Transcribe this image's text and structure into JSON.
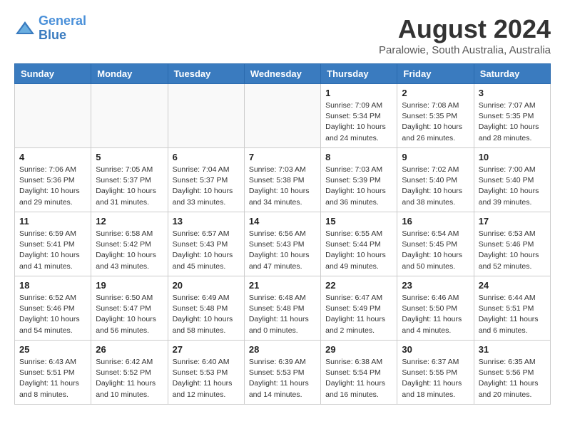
{
  "header": {
    "logo_line1": "General",
    "logo_line2": "Blue",
    "month": "August 2024",
    "location": "Paralowie, South Australia, Australia"
  },
  "weekdays": [
    "Sunday",
    "Monday",
    "Tuesday",
    "Wednesday",
    "Thursday",
    "Friday",
    "Saturday"
  ],
  "weeks": [
    [
      {
        "day": "",
        "info": ""
      },
      {
        "day": "",
        "info": ""
      },
      {
        "day": "",
        "info": ""
      },
      {
        "day": "",
        "info": ""
      },
      {
        "day": "1",
        "info": "Sunrise: 7:09 AM\nSunset: 5:34 PM\nDaylight: 10 hours\nand 24 minutes."
      },
      {
        "day": "2",
        "info": "Sunrise: 7:08 AM\nSunset: 5:35 PM\nDaylight: 10 hours\nand 26 minutes."
      },
      {
        "day": "3",
        "info": "Sunrise: 7:07 AM\nSunset: 5:35 PM\nDaylight: 10 hours\nand 28 minutes."
      }
    ],
    [
      {
        "day": "4",
        "info": "Sunrise: 7:06 AM\nSunset: 5:36 PM\nDaylight: 10 hours\nand 29 minutes."
      },
      {
        "day": "5",
        "info": "Sunrise: 7:05 AM\nSunset: 5:37 PM\nDaylight: 10 hours\nand 31 minutes."
      },
      {
        "day": "6",
        "info": "Sunrise: 7:04 AM\nSunset: 5:37 PM\nDaylight: 10 hours\nand 33 minutes."
      },
      {
        "day": "7",
        "info": "Sunrise: 7:03 AM\nSunset: 5:38 PM\nDaylight: 10 hours\nand 34 minutes."
      },
      {
        "day": "8",
        "info": "Sunrise: 7:03 AM\nSunset: 5:39 PM\nDaylight: 10 hours\nand 36 minutes."
      },
      {
        "day": "9",
        "info": "Sunrise: 7:02 AM\nSunset: 5:40 PM\nDaylight: 10 hours\nand 38 minutes."
      },
      {
        "day": "10",
        "info": "Sunrise: 7:00 AM\nSunset: 5:40 PM\nDaylight: 10 hours\nand 39 minutes."
      }
    ],
    [
      {
        "day": "11",
        "info": "Sunrise: 6:59 AM\nSunset: 5:41 PM\nDaylight: 10 hours\nand 41 minutes."
      },
      {
        "day": "12",
        "info": "Sunrise: 6:58 AM\nSunset: 5:42 PM\nDaylight: 10 hours\nand 43 minutes."
      },
      {
        "day": "13",
        "info": "Sunrise: 6:57 AM\nSunset: 5:43 PM\nDaylight: 10 hours\nand 45 minutes."
      },
      {
        "day": "14",
        "info": "Sunrise: 6:56 AM\nSunset: 5:43 PM\nDaylight: 10 hours\nand 47 minutes."
      },
      {
        "day": "15",
        "info": "Sunrise: 6:55 AM\nSunset: 5:44 PM\nDaylight: 10 hours\nand 49 minutes."
      },
      {
        "day": "16",
        "info": "Sunrise: 6:54 AM\nSunset: 5:45 PM\nDaylight: 10 hours\nand 50 minutes."
      },
      {
        "day": "17",
        "info": "Sunrise: 6:53 AM\nSunset: 5:46 PM\nDaylight: 10 hours\nand 52 minutes."
      }
    ],
    [
      {
        "day": "18",
        "info": "Sunrise: 6:52 AM\nSunset: 5:46 PM\nDaylight: 10 hours\nand 54 minutes."
      },
      {
        "day": "19",
        "info": "Sunrise: 6:50 AM\nSunset: 5:47 PM\nDaylight: 10 hours\nand 56 minutes."
      },
      {
        "day": "20",
        "info": "Sunrise: 6:49 AM\nSunset: 5:48 PM\nDaylight: 10 hours\nand 58 minutes."
      },
      {
        "day": "21",
        "info": "Sunrise: 6:48 AM\nSunset: 5:48 PM\nDaylight: 11 hours\nand 0 minutes."
      },
      {
        "day": "22",
        "info": "Sunrise: 6:47 AM\nSunset: 5:49 PM\nDaylight: 11 hours\nand 2 minutes."
      },
      {
        "day": "23",
        "info": "Sunrise: 6:46 AM\nSunset: 5:50 PM\nDaylight: 11 hours\nand 4 minutes."
      },
      {
        "day": "24",
        "info": "Sunrise: 6:44 AM\nSunset: 5:51 PM\nDaylight: 11 hours\nand 6 minutes."
      }
    ],
    [
      {
        "day": "25",
        "info": "Sunrise: 6:43 AM\nSunset: 5:51 PM\nDaylight: 11 hours\nand 8 minutes."
      },
      {
        "day": "26",
        "info": "Sunrise: 6:42 AM\nSunset: 5:52 PM\nDaylight: 11 hours\nand 10 minutes."
      },
      {
        "day": "27",
        "info": "Sunrise: 6:40 AM\nSunset: 5:53 PM\nDaylight: 11 hours\nand 12 minutes."
      },
      {
        "day": "28",
        "info": "Sunrise: 6:39 AM\nSunset: 5:53 PM\nDaylight: 11 hours\nand 14 minutes."
      },
      {
        "day": "29",
        "info": "Sunrise: 6:38 AM\nSunset: 5:54 PM\nDaylight: 11 hours\nand 16 minutes."
      },
      {
        "day": "30",
        "info": "Sunrise: 6:37 AM\nSunset: 5:55 PM\nDaylight: 11 hours\nand 18 minutes."
      },
      {
        "day": "31",
        "info": "Sunrise: 6:35 AM\nSunset: 5:56 PM\nDaylight: 11 hours\nand 20 minutes."
      }
    ]
  ]
}
